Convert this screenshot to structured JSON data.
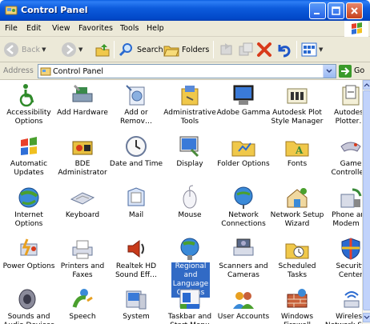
{
  "window": {
    "title": "Control Panel"
  },
  "menu": [
    "File",
    "Edit",
    "View",
    "Favorites",
    "Tools",
    "Help"
  ],
  "toolbar": {
    "back": "Back",
    "search": "Search",
    "folders": "Folders"
  },
  "address": {
    "label": "Address",
    "value": "Control Panel",
    "go": "Go"
  },
  "items": [
    {
      "label": "Accessibility Options",
      "icon": "accessibility-icon"
    },
    {
      "label": "Add Hardware",
      "icon": "add-hardware-icon"
    },
    {
      "label": "Add or Remov…",
      "icon": "add-remove-programs-icon"
    },
    {
      "label": "Administrative Tools",
      "icon": "administrative-tools-icon"
    },
    {
      "label": "Adobe Gamma",
      "icon": "adobe-gamma-icon"
    },
    {
      "label": "Autodesk Plot Style Manager",
      "icon": "autodesk-plot-style-icon"
    },
    {
      "label": "Autodesk Plotter…",
      "icon": "autodesk-plotter-icon"
    },
    {
      "label": "Automatic Updates",
      "icon": "automatic-updates-icon"
    },
    {
      "label": "BDE Administrator",
      "icon": "bde-administrator-icon"
    },
    {
      "label": "Date and Time",
      "icon": "date-time-icon"
    },
    {
      "label": "Display",
      "icon": "display-icon"
    },
    {
      "label": "Folder Options",
      "icon": "folder-options-icon"
    },
    {
      "label": "Fonts",
      "icon": "fonts-icon"
    },
    {
      "label": "Game Controllers",
      "icon": "game-controllers-icon"
    },
    {
      "label": "Internet Options",
      "icon": "internet-options-icon"
    },
    {
      "label": "Keyboard",
      "icon": "keyboard-icon"
    },
    {
      "label": "Mail",
      "icon": "mail-icon"
    },
    {
      "label": "Mouse",
      "icon": "mouse-icon"
    },
    {
      "label": "Network Connections",
      "icon": "network-connections-icon"
    },
    {
      "label": "Network Setup Wizard",
      "icon": "network-setup-icon"
    },
    {
      "label": "Phone and Modem …",
      "icon": "phone-modem-icon"
    },
    {
      "label": "Power Options",
      "icon": "power-options-icon"
    },
    {
      "label": "Printers and Faxes",
      "icon": "printers-faxes-icon"
    },
    {
      "label": "Realtek HD Sound Eff…",
      "icon": "realtek-sound-icon"
    },
    {
      "label": "Regional and Language Options",
      "icon": "regional-language-icon"
    },
    {
      "label": "Scanners and Cameras",
      "icon": "scanners-cameras-icon"
    },
    {
      "label": "Scheduled Tasks",
      "icon": "scheduled-tasks-icon"
    },
    {
      "label": "Security Center",
      "icon": "security-center-icon"
    },
    {
      "label": "Sounds and Audio Devices",
      "icon": "sounds-audio-icon"
    },
    {
      "label": "Speech",
      "icon": "speech-icon"
    },
    {
      "label": "System",
      "icon": "system-icon"
    },
    {
      "label": "Taskbar and Start Menu",
      "icon": "taskbar-start-menu-icon"
    },
    {
      "label": "User Accounts",
      "icon": "user-accounts-icon"
    },
    {
      "label": "Windows Firewall",
      "icon": "windows-firewall-icon"
    },
    {
      "label": "Wireless Network Set…",
      "icon": "wireless-network-icon"
    }
  ],
  "selected_item": "Regional and Language Options"
}
